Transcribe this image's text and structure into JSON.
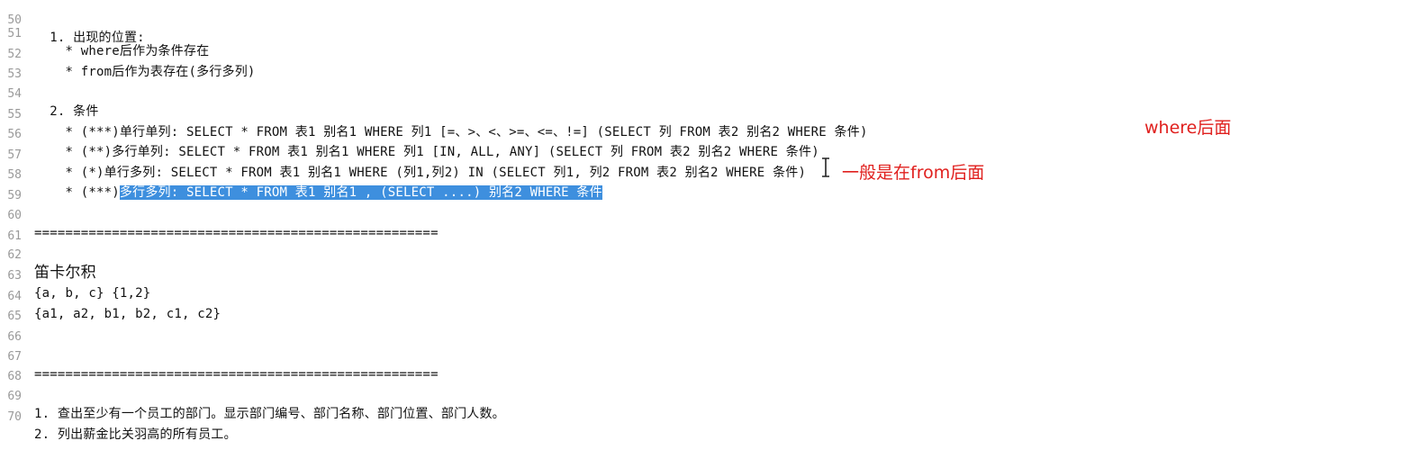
{
  "editor": {
    "lines": [
      {
        "num": "50",
        "text": "  1. 出现的位置:"
      },
      {
        "num": "51",
        "text": "    * where后作为条件存在"
      },
      {
        "num": "52",
        "text": "    * from后作为表存在(多行多列)"
      },
      {
        "num": "53",
        "text": ""
      },
      {
        "num": "54",
        "text": "  2. 条件"
      },
      {
        "num": "55",
        "text": "    * (***)单行单列: SELECT * FROM 表1 别名1 WHERE 列1 [=、>、<、>=、<=、!=] (SELECT 列 FROM 表2 别名2 WHERE 条件)"
      },
      {
        "num": "56",
        "text": "    * (**)多行单列: SELECT * FROM 表1 别名1 WHERE 列1 [IN, ALL, ANY] (SELECT 列 FROM 表2 别名2 WHERE 条件)"
      },
      {
        "num": "57",
        "text": "    * (*)单行多列: SELECT * FROM 表1 别名1 WHERE (列1,列2) IN (SELECT 列1, 列2 FROM 表2 别名2 WHERE 条件)"
      },
      {
        "num": "58",
        "prefix": "    * (***)",
        "selected": "多行多列: SELECT * FROM 表1 别名1 , (SELECT ....) 别名2 WHERE 条件"
      },
      {
        "num": "59",
        "text": ""
      },
      {
        "num": "60",
        "text": "===================================================="
      },
      {
        "num": "61",
        "text": ""
      },
      {
        "num": "62",
        "text": "笛卡尔积"
      },
      {
        "num": "63",
        "text": "{a, b, c} {1,2}"
      },
      {
        "num": "64",
        "text": "{a1, a2, b1, b2, c1, c2}"
      },
      {
        "num": "65",
        "text": ""
      },
      {
        "num": "66",
        "text": ""
      },
      {
        "num": "67",
        "text": "===================================================="
      },
      {
        "num": "68",
        "text": ""
      },
      {
        "num": "69",
        "text": "1. 查出至少有一个员工的部门。显示部门编号、部门名称、部门位置、部门人数。"
      },
      {
        "num": "70",
        "text": "2. 列出薪金比关羽高的所有员工。"
      }
    ]
  },
  "annotations": {
    "where_note": "where后面",
    "from_note": "一般是在from后面"
  },
  "colors": {
    "selection": "#3e8fde",
    "annotation": "#e0201e",
    "line_number": "#9a9a9a"
  }
}
